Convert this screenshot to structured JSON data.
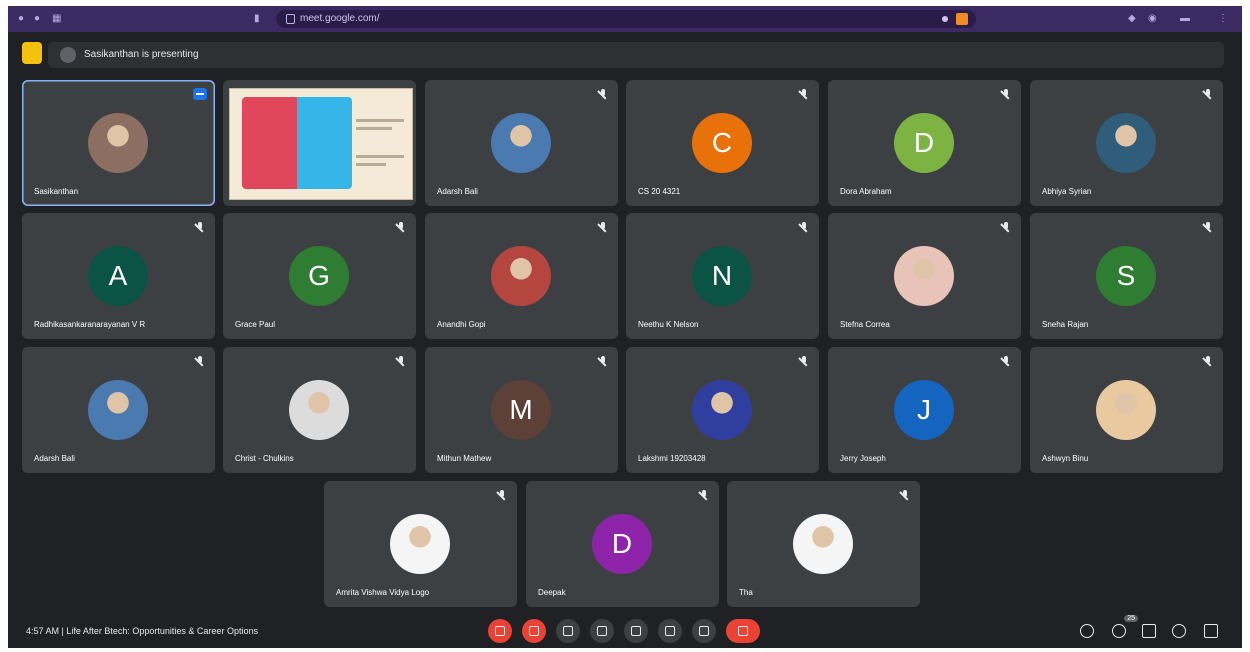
{
  "browser": {
    "url": "meet.google.com/"
  },
  "presenter": {
    "text": "Sasikanthan is presenting"
  },
  "tiles": [
    {
      "name": "Sasikanthan",
      "type": "photo",
      "color": "#8d6e63",
      "pinned": true
    },
    {
      "name": "",
      "type": "slide"
    },
    {
      "name": "Adarsh Bali",
      "type": "photo",
      "color": "#4a7ab0"
    },
    {
      "name": "CS 20 4321",
      "type": "initial",
      "initial": "C",
      "color": "#e8710a"
    },
    {
      "name": "Dora Abraham",
      "type": "initial",
      "initial": "D",
      "color": "#7cb342"
    },
    {
      "name": "Abhiya Syrian",
      "type": "photo",
      "color": "#2f5d7a"
    },
    {
      "name": "Radhikasankaranarayanan V R",
      "type": "initial",
      "initial": "A",
      "color": "#0b5345"
    },
    {
      "name": "Grace Paul",
      "type": "initial",
      "initial": "G",
      "color": "#2e7d32"
    },
    {
      "name": "Anandhi Gopi",
      "type": "photo",
      "color": "#b5453f"
    },
    {
      "name": "Neethu K Nelson",
      "type": "initial",
      "initial": "N",
      "color": "#0b5345"
    },
    {
      "name": "Stefna Correa",
      "type": "photo",
      "color": "#e8c3b8"
    },
    {
      "name": "Sneha Rajan",
      "type": "initial",
      "initial": "S",
      "color": "#2e7d32"
    },
    {
      "name": "Adarsh Bali",
      "type": "photo",
      "color": "#4a7ab0"
    },
    {
      "name": "Christ - Chulkins",
      "type": "photo",
      "color": "#dcdcdc"
    },
    {
      "name": "Mithun Mathew",
      "type": "initial",
      "initial": "M",
      "color": "#5d4037"
    },
    {
      "name": "Lakshmi 19203428",
      "type": "photo",
      "color": "#303f9f"
    },
    {
      "name": "Jerry Joseph",
      "type": "initial",
      "initial": "J",
      "color": "#1565c0"
    },
    {
      "name": "Ashwyn Binu",
      "type": "photo",
      "color": "#e8c9a0"
    },
    {
      "name": "Amrita Vishwa Vidya Logo",
      "type": "photo",
      "color": "#f5f5f5"
    },
    {
      "name": "Deepak",
      "type": "initial",
      "initial": "D",
      "color": "#8e24aa"
    },
    {
      "name": "Tha",
      "type": "photo",
      "color": "#f5f5f5"
    }
  ],
  "footer": {
    "meeting_info": "4:57 AM  |  Life After Btech: Opportunities & Career Options",
    "participant_count": "25"
  }
}
